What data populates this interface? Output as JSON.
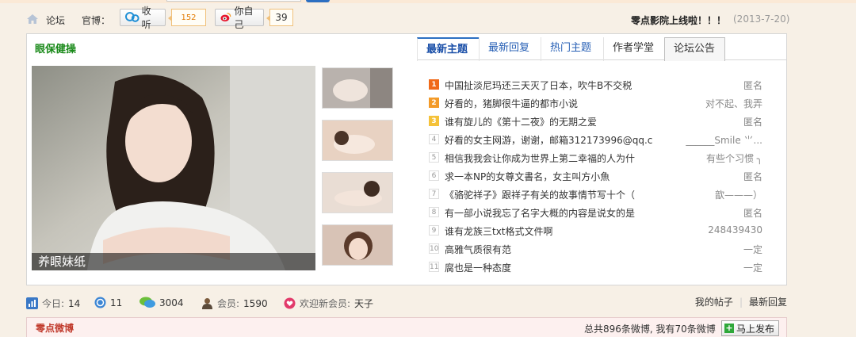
{
  "header": {
    "breadcrumb": "论坛",
    "weibo_label": "官博：",
    "listen_button": "收听",
    "listen_count": "152",
    "self_button": "你自己",
    "self_count": "39",
    "notice": "零点影院上线啦！！！",
    "notice_date": "(2013-7-20)"
  },
  "panel": {
    "title": "眼保健操",
    "image_caption": "养眼妹纸",
    "tabs": [
      "最新主题",
      "最新回复",
      "热门主题",
      "作者学堂",
      "论坛公告"
    ],
    "topics": [
      {
        "num": "1",
        "title": "中国扯淡尼玛还三天灭了日本，吹牛B不交税",
        "author": "匿名"
      },
      {
        "num": "2",
        "title": "好看的，猪脚很牛逼的都市小说",
        "author": "对不起、我弄"
      },
      {
        "num": "3",
        "title": "谁有旋儿的《第十二夜》的无期之爱",
        "author": "匿名"
      },
      {
        "num": "4",
        "title": "好看的女主网游，谢谢，邮箱312173996@qq.c",
        "author": "______Smile ⺌..."
      },
      {
        "num": "5",
        "title": "相信我我会让你成为世界上第二幸福的人为什",
        "author": "有些个习惯 ╮"
      },
      {
        "num": "6",
        "title": "求一本NP的女尊文書名，女主叫方小魚",
        "author": "匿名"
      },
      {
        "num": "7",
        "title": "《骆驼祥子》跟祥子有关的故事情节写十个（",
        "author": "歆———）"
      },
      {
        "num": "8",
        "title": "有一部小说我忘了名字大概的内容是说女的是",
        "author": "匿名"
      },
      {
        "num": "9",
        "title": "谁有龙族三txt格式文件啊",
        "author": "248439430"
      },
      {
        "num": "10",
        "title": "高雅气质很有范",
        "author": "一定"
      },
      {
        "num": "11",
        "title": "腐也是一种态度",
        "author": "一定"
      }
    ]
  },
  "stats": {
    "today_label": "今日:",
    "today_value": "14",
    "yesterday_value": "11",
    "posts_value": "3004",
    "members_label": "会员:",
    "members_value": "1590",
    "welcome_label": "欢迎新会员:",
    "welcome_name": "天子",
    "my_posts": "我的帖子",
    "latest_reply": "最新回复"
  },
  "weibo": {
    "title": "零点微博",
    "count_text": "总共896条微博, 我有70条微博",
    "post_button": "马上发布"
  }
}
